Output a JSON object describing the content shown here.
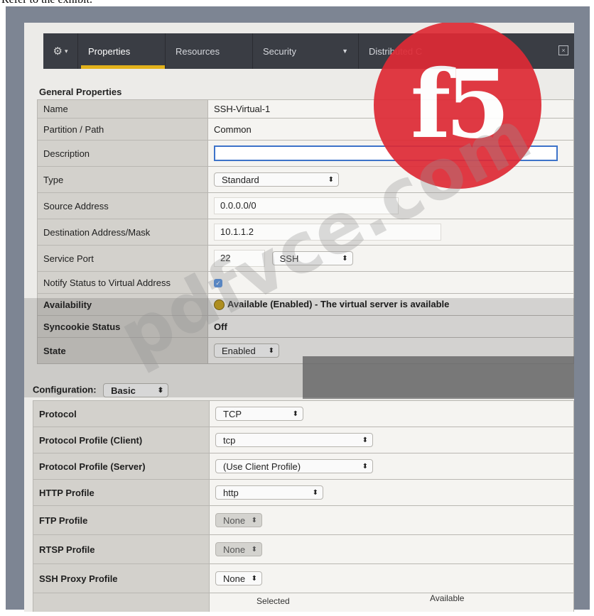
{
  "caption": "Refer to the exhibit.",
  "toolbar": {
    "tabs": [
      "Properties",
      "Resources",
      "Security",
      "Distributed C"
    ],
    "close": "×"
  },
  "general": {
    "title": "General Properties",
    "name_label": "Name",
    "name_value": "SSH-Virtual-1",
    "partition_label": "Partition / Path",
    "partition_value": "Common",
    "description_label": "Description",
    "description_value": "",
    "type_label": "Type",
    "type_value": "Standard",
    "source_label": "Source Address",
    "source_value": "0.0.0.0/0",
    "dest_label": "Destination Address/Mask",
    "dest_value": "10.1.1.2",
    "port_label": "Service Port",
    "port_value": "22",
    "port_service": "SSH",
    "notify_label": "Notify Status to Virtual Address",
    "notify_checked": true,
    "availability_label": "Availability",
    "availability_value": "Available (Enabled) - The virtual server is available",
    "syncookie_label": "Syncookie Status",
    "syncookie_value": "Off",
    "state_label": "State",
    "state_value": "Enabled"
  },
  "configuration": {
    "title": "Configuration:",
    "mode": "Basic",
    "protocol_label": "Protocol",
    "protocol_value": "TCP",
    "client_label": "Protocol Profile (Client)",
    "client_value": "tcp",
    "server_label": "Protocol Profile (Server)",
    "server_value": "(Use Client Profile)",
    "http_label": "HTTP Profile",
    "http_value": "http",
    "ftp_label": "FTP Profile",
    "ftp_value": "None",
    "rtsp_label": "RTSP Profile",
    "rtsp_value": "None",
    "ssh_label": "SSH Proxy Profile",
    "ssh_value": "None",
    "selected_header": "Selected",
    "available_header": "Available"
  },
  "logo_text": "f5",
  "watermark_text": "pdfvce.com"
}
